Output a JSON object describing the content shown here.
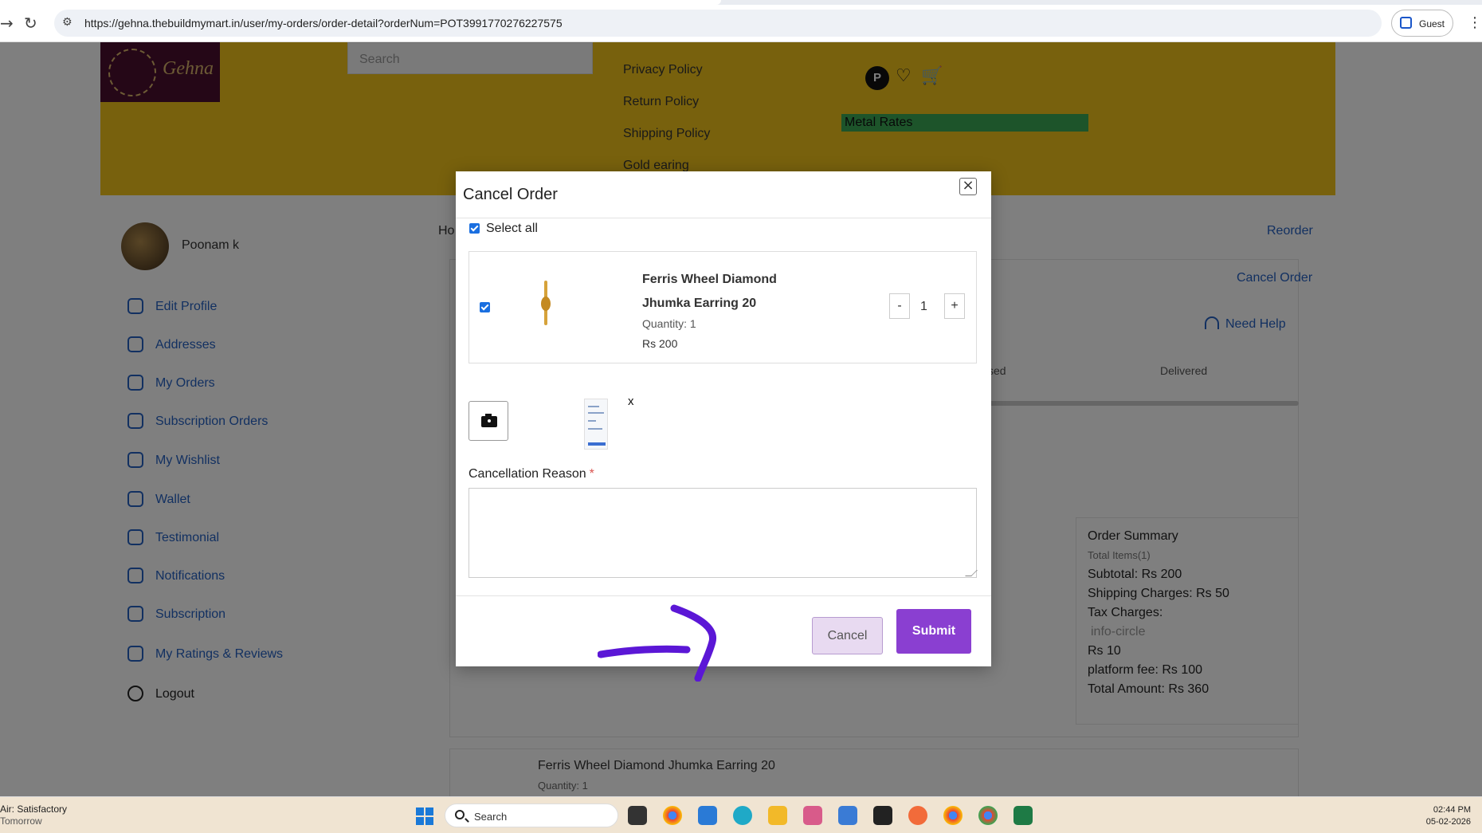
{
  "browser": {
    "url": "https://gehna.thebuildmymart.in/user/my-orders/order-detail?orderNum=POT3991770276227575",
    "profile_label": "Guest"
  },
  "header": {
    "logo_text": "Gehna",
    "search_placeholder": "Search",
    "menu": [
      "Privacy Policy",
      "Return Policy",
      "Shipping Policy",
      "Gold earing"
    ],
    "avatar_initial": "P",
    "metal_rates": "Metal Rates"
  },
  "sidebar": {
    "user_name": "Poonam k",
    "items": [
      "Edit Profile",
      "Addresses",
      "My Orders",
      "Subscription Orders",
      "My Wishlist",
      "Wallet",
      "Testimonial",
      "Notifications",
      "Subscription",
      "My Ratings & Reviews",
      "Logout"
    ]
  },
  "main": {
    "breadcrumb": "Ho",
    "reorder": "Reorder",
    "cancel_order": "Cancel Order",
    "need_help": "Need Help",
    "tracking_labels": [
      "sed",
      "Delivered"
    ],
    "summary": {
      "title": "Order Summary",
      "total_items": "Total Items(1)",
      "subtotal": "Subtotal: Rs 200",
      "shipping": "Shipping Charges: Rs 50",
      "tax": "Tax Charges:",
      "tax_icon": "info-circle",
      "tax_value": "Rs 10",
      "platform": "platform fee: Rs 100",
      "total": "Total Amount: Rs 360"
    },
    "lower_item": {
      "title": "Ferris Wheel Diamond Jhumka Earring 20",
      "sub": "Quantity: 1"
    }
  },
  "modal": {
    "title": "Cancel Order",
    "close": "×",
    "select_all": "Select all",
    "product": {
      "name": "Ferris Wheel Diamond Jhumka Earring 20",
      "quantity": "Quantity: 1",
      "price": "Rs 200",
      "qty_minus": "-",
      "qty_value": "1",
      "qty_plus": "+"
    },
    "remove_image": "x",
    "reason_label": "Cancellation Reason",
    "reason_required": "*",
    "reason_value": "",
    "cancel_label": "Cancel",
    "submit_label": "Submit",
    "annotation_color": "#5b17d6"
  },
  "taskbar": {
    "weather_line1": "Air: Satisfactory",
    "weather_line2": "Tomorrow",
    "search_label": "Search",
    "time": "02:44 PM",
    "date": "05-02-2026"
  }
}
